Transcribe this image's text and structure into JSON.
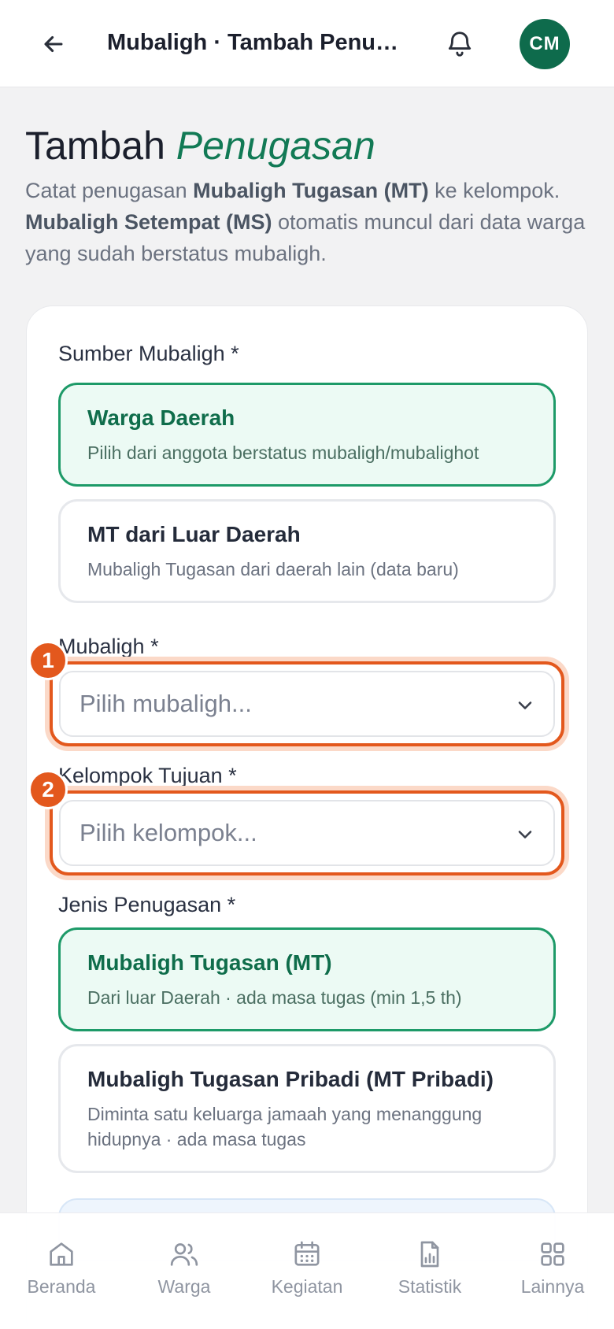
{
  "topbar": {
    "title": "Mubaligh · Tambah Penugasan",
    "avatar_initials": "CM",
    "avatar_color": "#0e6b4c"
  },
  "heading": {
    "main": "Tambah",
    "accent": "Penugasan"
  },
  "intro": {
    "part1": "Catat penugasan ",
    "mt_bold": "Mubaligh Tugasan (MT)",
    "part2": " ke kelompok. ",
    "ms_bold": "Mubaligh Setempat (MS)",
    "part3": " otomatis muncul dari data warga yang sudah berstatus mubaligh."
  },
  "form": {
    "source_label": "Sumber Mubaligh *",
    "source_options": [
      {
        "title": "Warga Daerah",
        "desc": "Pilih dari anggota berstatus mubaligh/mubalighot",
        "selected": true
      },
      {
        "title": "MT dari Luar Daerah",
        "desc": "Mubaligh Tugasan dari daerah lain (data baru)",
        "selected": false
      }
    ],
    "mubaligh_label": "Mubaligh *",
    "mubaligh_placeholder": "Pilih mubaligh...",
    "kelompok_label": "Kelompok Tujuan *",
    "kelompok_placeholder": "Pilih kelompok...",
    "jenis_label": "Jenis Penugasan *",
    "jenis_options": [
      {
        "title": "Mubaligh Tugasan (MT)",
        "desc": "Dari luar Daerah · ada masa tugas (min 1,5 th)",
        "selected": true
      },
      {
        "title": "Mubaligh Tugasan Pribadi (MT Pribadi)",
        "desc": "Diminta satu keluarga jamaah yang menanggung hidupnya · ada masa tugas",
        "selected": false
      }
    ]
  },
  "badges": [
    "1",
    "2"
  ],
  "colors": {
    "accent_green": "#127a55",
    "highlight_orange": "#e3581d"
  },
  "nav": [
    {
      "label": "Beranda",
      "icon": "home-icon"
    },
    {
      "label": "Warga",
      "icon": "users-icon"
    },
    {
      "label": "Kegiatan",
      "icon": "calendar-icon"
    },
    {
      "label": "Statistik",
      "icon": "report-chart-icon"
    },
    {
      "label": "Lainnya",
      "icon": "grid-icon"
    }
  ]
}
